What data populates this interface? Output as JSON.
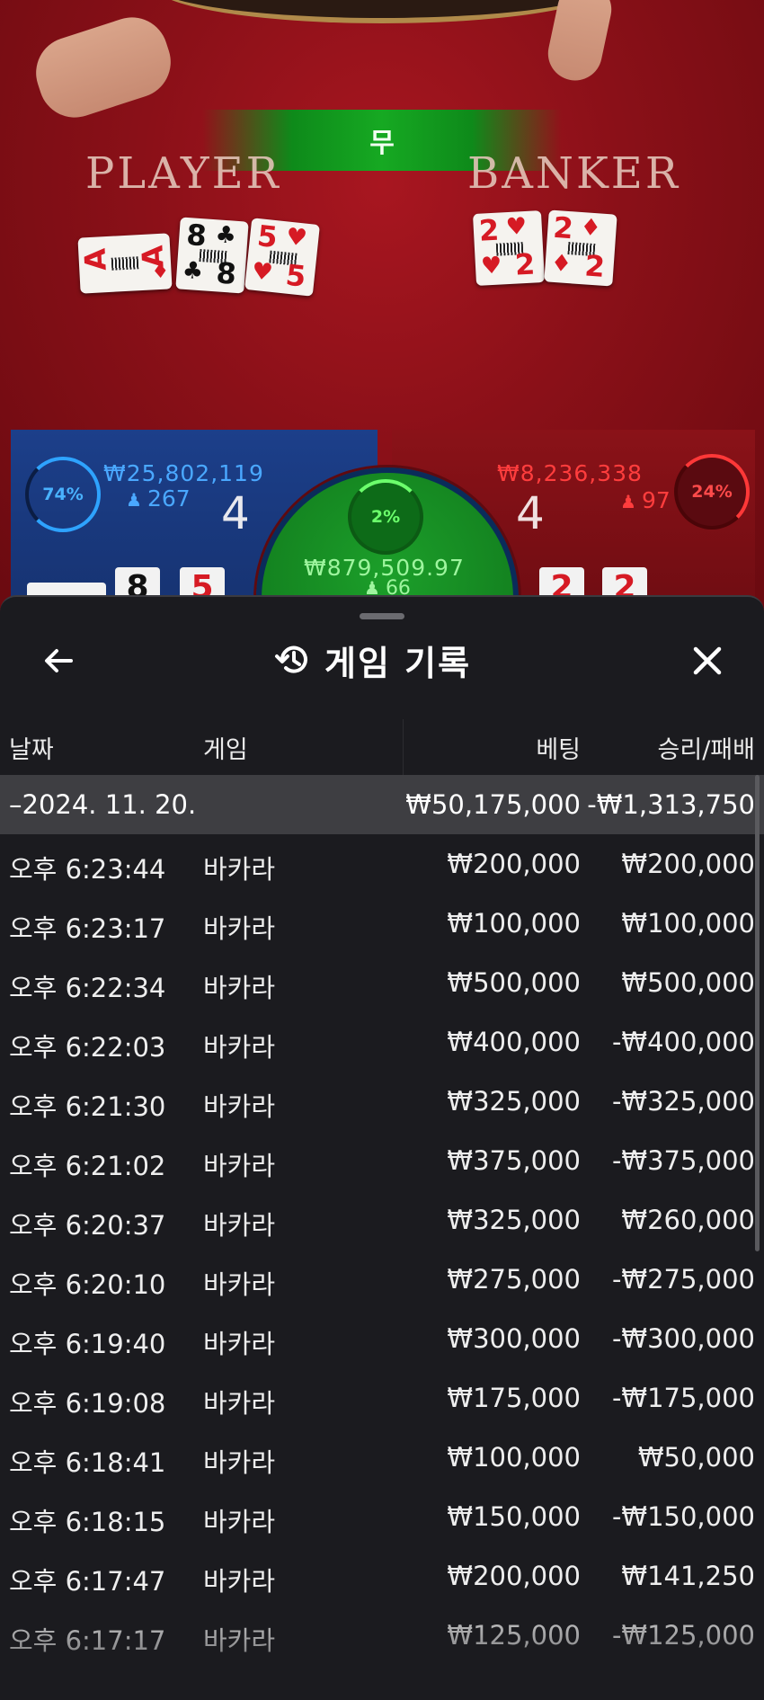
{
  "game_view": {
    "result_label": "무",
    "player_title": "PLAYER",
    "banker_title": "BANKER",
    "player": {
      "percent": "74%",
      "amount": "₩25,802,119",
      "bettors": "267",
      "score": "4",
      "cards": [
        {
          "rank": "A",
          "suit": "♦",
          "color": "red"
        },
        {
          "rank": "8",
          "suit": "♣",
          "color": "black"
        },
        {
          "rank": "5",
          "suit": "♥",
          "color": "red"
        }
      ],
      "mini_cards": [
        "8",
        "5"
      ]
    },
    "banker": {
      "percent": "24%",
      "amount": "₩8,236,338",
      "bettors": "97",
      "score": "4",
      "cards": [
        {
          "rank": "2",
          "suit": "♥",
          "color": "red"
        },
        {
          "rank": "2",
          "suit": "♦",
          "color": "red"
        }
      ],
      "mini_cards": [
        "2",
        "2"
      ]
    },
    "tie": {
      "percent": "2%",
      "amount": "₩879,509.97",
      "bettors": "66"
    }
  },
  "history": {
    "title": "게임 기록",
    "columns": {
      "date": "날짜",
      "game": "게임",
      "bet": "베팅",
      "win_loss": "승리/패배"
    },
    "date_group": {
      "date": "–2024. 11. 20.",
      "bet": "₩50,175,000",
      "win_loss": "-₩1,313,750"
    },
    "rows": [
      {
        "time": "오후 6:23:44",
        "game": "바카라",
        "bet": "₩200,000",
        "win_loss": "₩200,000"
      },
      {
        "time": "오후 6:23:17",
        "game": "바카라",
        "bet": "₩100,000",
        "win_loss": "₩100,000"
      },
      {
        "time": "오후 6:22:34",
        "game": "바카라",
        "bet": "₩500,000",
        "win_loss": "₩500,000"
      },
      {
        "time": "오후 6:22:03",
        "game": "바카라",
        "bet": "₩400,000",
        "win_loss": "-₩400,000"
      },
      {
        "time": "오후 6:21:30",
        "game": "바카라",
        "bet": "₩325,000",
        "win_loss": "-₩325,000"
      },
      {
        "time": "오후 6:21:02",
        "game": "바카라",
        "bet": "₩375,000",
        "win_loss": "-₩375,000"
      },
      {
        "time": "오후 6:20:37",
        "game": "바카라",
        "bet": "₩325,000",
        "win_loss": "₩260,000"
      },
      {
        "time": "오후 6:20:10",
        "game": "바카라",
        "bet": "₩275,000",
        "win_loss": "-₩275,000"
      },
      {
        "time": "오후 6:19:40",
        "game": "바카라",
        "bet": "₩300,000",
        "win_loss": "-₩300,000"
      },
      {
        "time": "오후 6:19:08",
        "game": "바카라",
        "bet": "₩175,000",
        "win_loss": "-₩175,000"
      },
      {
        "time": "오후 6:18:41",
        "game": "바카라",
        "bet": "₩100,000",
        "win_loss": "₩50,000"
      },
      {
        "time": "오후 6:18:15",
        "game": "바카라",
        "bet": "₩150,000",
        "win_loss": "-₩150,000"
      },
      {
        "time": "오후 6:17:47",
        "game": "바카라",
        "bet": "₩200,000",
        "win_loss": "₩141,250"
      },
      {
        "time": "오후 6:17:17",
        "game": "바카라",
        "bet": "₩125,000",
        "win_loss": "-₩125,000"
      }
    ]
  },
  "icons": {
    "back": "arrow-left-icon",
    "history": "history-clock-icon",
    "close": "close-x-icon",
    "person": "person-icon"
  },
  "colors": {
    "player_blue": "#2ea3ff",
    "banker_red": "#ff3838",
    "tie_green": "#16a922",
    "sheet_bg": "#1b1b1f",
    "date_row_bg": "#3e3e42"
  }
}
